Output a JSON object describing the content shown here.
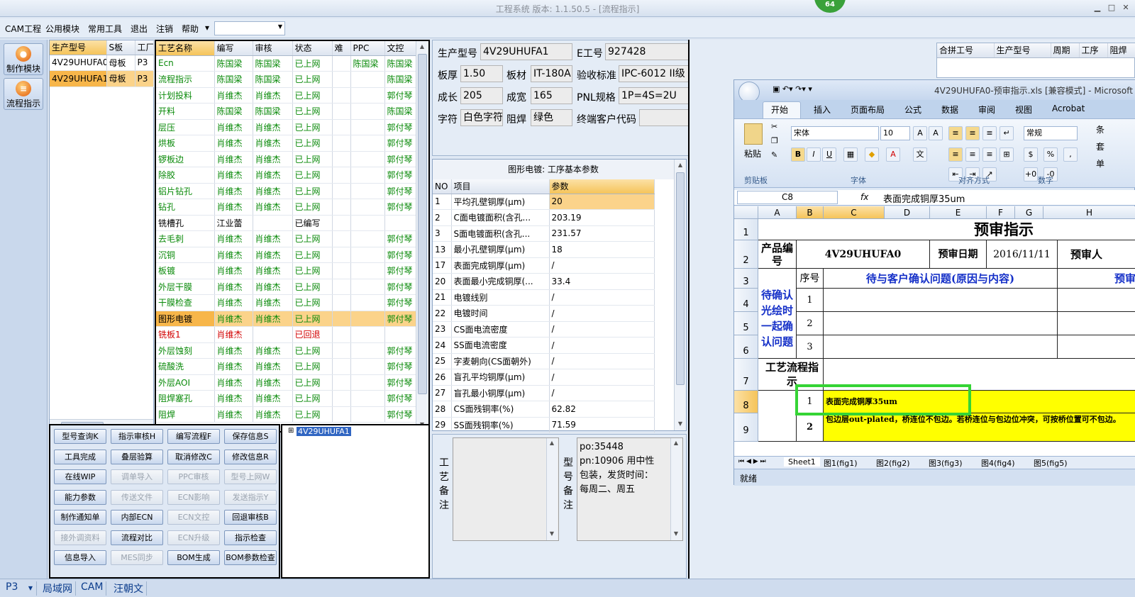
{
  "window": {
    "title": "工程系统    版本: 1.1.50.5 - [流程指示]",
    "badge": "64"
  },
  "menu": {
    "items": [
      "CAM工程",
      "公用模块",
      "常用工具",
      "退出",
      "注销",
      "帮助"
    ],
    "dropdown_arrow": "▾",
    "combo_value": ""
  },
  "nav": {
    "btn1": "制作模块",
    "btn2": "流程指示"
  },
  "parts": {
    "headers": [
      "生产型号",
      "S板",
      "工厂"
    ],
    "rows": [
      [
        "4V29UHUFA0",
        "母板",
        "P3"
      ],
      [
        "4V29UHUFA1",
        "母板",
        "P3"
      ]
    ]
  },
  "process": {
    "headers": [
      "工艺名称",
      "编写",
      "审核",
      "状态",
      "难",
      "PPC",
      "文控"
    ],
    "rows": [
      [
        "Ecn",
        "陈国梁",
        "陈国梁",
        "已上网",
        "",
        "陈国梁",
        "陈国梁"
      ],
      [
        "流程指示",
        "陈国梁",
        "陈国梁",
        "已上网",
        "",
        "",
        "陈国梁"
      ],
      [
        "计划投料",
        "肖维杰",
        "肖维杰",
        "已上网",
        "",
        "",
        "郭付琴"
      ],
      [
        "开料",
        "陈国梁",
        "陈国梁",
        "已上网",
        "",
        "",
        "陈国梁"
      ],
      [
        "层压",
        "肖维杰",
        "肖维杰",
        "已上网",
        "",
        "",
        "郭付琴"
      ],
      [
        "烘板",
        "肖维杰",
        "肖维杰",
        "已上网",
        "",
        "",
        "郭付琴"
      ],
      [
        "锣板边",
        "肖维杰",
        "肖维杰",
        "已上网",
        "",
        "",
        "郭付琴"
      ],
      [
        "除胶",
        "肖维杰",
        "肖维杰",
        "已上网",
        "",
        "",
        "郭付琴"
      ],
      [
        "铝片钻孔",
        "肖维杰",
        "肖维杰",
        "已上网",
        "",
        "",
        "郭付琴"
      ],
      [
        "钻孔",
        "肖维杰",
        "肖维杰",
        "已上网",
        "",
        "",
        "郭付琴"
      ],
      [
        "铣槽孔",
        "江业蕾",
        "",
        "已编写",
        "",
        "",
        ""
      ],
      [
        "去毛刺",
        "肖维杰",
        "肖维杰",
        "已上网",
        "",
        "",
        "郭付琴"
      ],
      [
        "沉铜",
        "肖维杰",
        "肖维杰",
        "已上网",
        "",
        "",
        "郭付琴"
      ],
      [
        "板镀",
        "肖维杰",
        "肖维杰",
        "已上网",
        "",
        "",
        "郭付琴"
      ],
      [
        "外层干膜",
        "肖维杰",
        "肖维杰",
        "已上网",
        "",
        "",
        "郭付琴"
      ],
      [
        "干膜检查",
        "肖维杰",
        "肖维杰",
        "已上网",
        "",
        "",
        "郭付琴"
      ],
      [
        "图形电镀",
        "肖维杰",
        "肖维杰",
        "已上网",
        "",
        "",
        "郭付琴"
      ],
      [
        "铣板1",
        "肖维杰",
        "",
        "已回退",
        "",
        "",
        ""
      ],
      [
        "外层蚀刻",
        "肖维杰",
        "肖维杰",
        "已上网",
        "",
        "",
        "郭付琴"
      ],
      [
        "硫酸洗",
        "肖维杰",
        "肖维杰",
        "已上网",
        "",
        "",
        "郭付琴"
      ],
      [
        "外层AOI",
        "肖维杰",
        "肖维杰",
        "已上网",
        "",
        "",
        "郭付琴"
      ],
      [
        "阻焊塞孔",
        "肖维杰",
        "肖维杰",
        "已上网",
        "",
        "",
        "郭付琴"
      ],
      [
        "阻焊",
        "肖维杰",
        "肖维杰",
        "已上网",
        "",
        "",
        "郭付琴"
      ]
    ]
  },
  "actions": [
    [
      "型号查询K",
      "指示审核H",
      "编写流程F",
      "保存信息S"
    ],
    [
      "工具完成",
      "叠层验算",
      "取消修改C",
      "修改信息R"
    ],
    [
      "在线WIP",
      "调单导入",
      "PPC审核",
      "型号上网W"
    ],
    [
      "能力参数",
      "传送文件",
      "ECN影响",
      "发送指示Y"
    ],
    [
      "制作通知单",
      "内部ECN",
      "ECN文控",
      "回退审核B"
    ],
    [
      "接外调资料",
      "流程对比",
      "ECN升级",
      "指示检查"
    ],
    [
      "信息导入",
      "MES同步",
      "BOM生成",
      "BOM参数检查"
    ]
  ],
  "tree": {
    "node": "4V29UHUFA1",
    "expander": "⊞"
  },
  "info": {
    "model_label": "生产型号",
    "model": "4V29UHUFA1",
    "eno_label": "E工号",
    "eno": "927428",
    "thick_label": "板厚",
    "thick": "1.50",
    "mat_label": "板材",
    "mat": "IT-180A",
    "std_label": "验收标准",
    "std": "IPC-6012 II级",
    "len_label": "成长",
    "len": "205",
    "wid_label": "成宽",
    "wid": "165",
    "pnl_label": "PNL规格",
    "pnl": "1P=4S=2U",
    "char_label": "字符",
    "char": "白色字符",
    "solder_label": "阻焊",
    "solder": "绿色",
    "cust_label": "终端客户代码",
    "cust": ""
  },
  "params": {
    "title": "图形电镀: 工序基本参数",
    "headers": [
      "NO",
      "项目",
      "参数"
    ],
    "rows": [
      [
        "1",
        "平均孔壁铜厚(μm)",
        "20"
      ],
      [
        "2",
        "C面电镀面积(含孔...",
        "203.19"
      ],
      [
        "3",
        "S面电镀面积(含孔...",
        "231.57"
      ],
      [
        "13",
        "最小孔壁铜厚(μm)",
        "18"
      ],
      [
        "17",
        "表面完成铜厚(μm)",
        "/"
      ],
      [
        "20",
        "表面最小完成铜厚(...",
        "33.4"
      ],
      [
        "21",
        "电镀线别",
        "/"
      ],
      [
        "22",
        "电镀时间",
        "/"
      ],
      [
        "23",
        "CS面电流密度",
        "/"
      ],
      [
        "24",
        "SS面电流密度",
        "/"
      ],
      [
        "25",
        "字麦朝向(CS面朝外)",
        "/"
      ],
      [
        "26",
        "盲孔平均铜厚(μm)",
        "/"
      ],
      [
        "27",
        "盲孔最小铜厚(μm)",
        "/"
      ],
      [
        "28",
        "CS面残铜率(%)",
        "62.82"
      ],
      [
        "29",
        "SS面残铜率(%)",
        "71.59"
      ]
    ]
  },
  "memo": {
    "proc_label": "工艺备注",
    "model_label": "型号备注",
    "model_memo": [
      "po:35448",
      "pn:10906 用中性",
      "包装，发货时间：",
      "每周二、周五"
    ]
  },
  "merge": {
    "headers": [
      "合拼工号",
      "生产型号",
      "周期",
      "工序",
      "阻焊"
    ]
  },
  "excel": {
    "title": "4V29UHUFA0-预审指示.xls [兼容模式] - Microsoft",
    "tabs": [
      "开始",
      "插入",
      "页面布局",
      "公式",
      "数据",
      "审阅",
      "视图",
      "Acrobat"
    ],
    "font": "宋体",
    "size": "10",
    "numfmt": "常规",
    "groups": [
      "剪贴板",
      "字体",
      "对齐方式",
      "数字"
    ],
    "paste": "粘贴",
    "bold": "B",
    "italic": "I",
    "underline": "U",
    "right_labels": [
      "条",
      "套",
      "单"
    ],
    "cellref": "C8",
    "formula": "表面完成铜厚35um",
    "fx": "fx",
    "cols": [
      "A",
      "B",
      "C",
      "D",
      "E",
      "F",
      "G",
      "H"
    ],
    "rows": [
      "1",
      "2",
      "3",
      "4",
      "5",
      "6",
      "7",
      "8",
      "9"
    ],
    "sheet": {
      "heading": "预审指示",
      "product": "产品编号",
      "pn": "4V29UHUFA0",
      "date_label": "预审日期",
      "date": "2016/11/11",
      "reviewer": "预审人",
      "seq": "序号",
      "question": "待与客户确认问题(原因与内容)",
      "pre": "预审",
      "confirm": "待确认光绘时一起确认问题",
      "n1": "1",
      "n2": "2",
      "n3": "3",
      "flow": "工艺流程指示",
      "r8": "表面完成铜厚35um",
      "r9": "包边层out-plated，桥连位不包边。若桥连位与包边位冲突，可按桥位置可不包边。"
    },
    "sheets": [
      "Sheet1",
      "图1(fig1)",
      "图2(fig2)",
      "图3(fig3)",
      "图4(fig4)",
      "图5(fig5)"
    ],
    "status": "就绪"
  },
  "status": {
    "plant": "P3",
    "items": [
      "局域网",
      "CAM",
      "汪朝文"
    ]
  }
}
